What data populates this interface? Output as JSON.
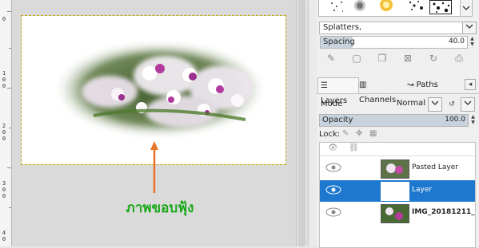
{
  "ruler": {
    "labels": [
      {
        "text": "0"
      },
      {
        "text": "1"
      },
      {
        "text": "0"
      },
      {
        "text": "0"
      },
      {
        "text": "2"
      },
      {
        "text": "0"
      },
      {
        "text": "0"
      },
      {
        "text": "3"
      },
      {
        "text": "0"
      },
      {
        "text": "0"
      },
      {
        "text": "4"
      },
      {
        "text": "0"
      }
    ]
  },
  "canvas": {
    "caption": "ภาพขอบฟุ้ง",
    "arrow_color": "#e8742a",
    "caption_color": "#1aa81a"
  },
  "brushes": {
    "preset_name": "Splatters,",
    "spacing_label": "Spacing",
    "spacing_value": "40.0",
    "spacing_fraction": 0.22
  },
  "brush_tools": [
    "edit-brush-icon",
    "new-brush-icon",
    "duplicate-brush-icon",
    "delete-brush-icon",
    "refresh-brushes-icon",
    "open-brush-as-image-icon"
  ],
  "tabs": [
    {
      "label": "Layers",
      "icon": "layers-icon",
      "active": true
    },
    {
      "label": "Channels",
      "icon": "channels-icon",
      "active": false
    },
    {
      "label": "Paths",
      "icon": "paths-icon",
      "active": false
    }
  ],
  "layers_panel": {
    "mode_label": "Mode",
    "mode_value": "Normal",
    "opacity_label": "Opacity",
    "opacity_value": "100.0",
    "lock_label": "Lock:"
  },
  "layers": [
    {
      "name": "Pasted Layer",
      "selected": false,
      "thumb": "flowers"
    },
    {
      "name": "Layer",
      "selected": true,
      "thumb": "white"
    },
    {
      "name": "IMG_20181211_",
      "selected": false,
      "thumb": "flowers"
    }
  ],
  "colors": {
    "selection": "#1f78d0",
    "selection_outline": "#c6a300"
  }
}
